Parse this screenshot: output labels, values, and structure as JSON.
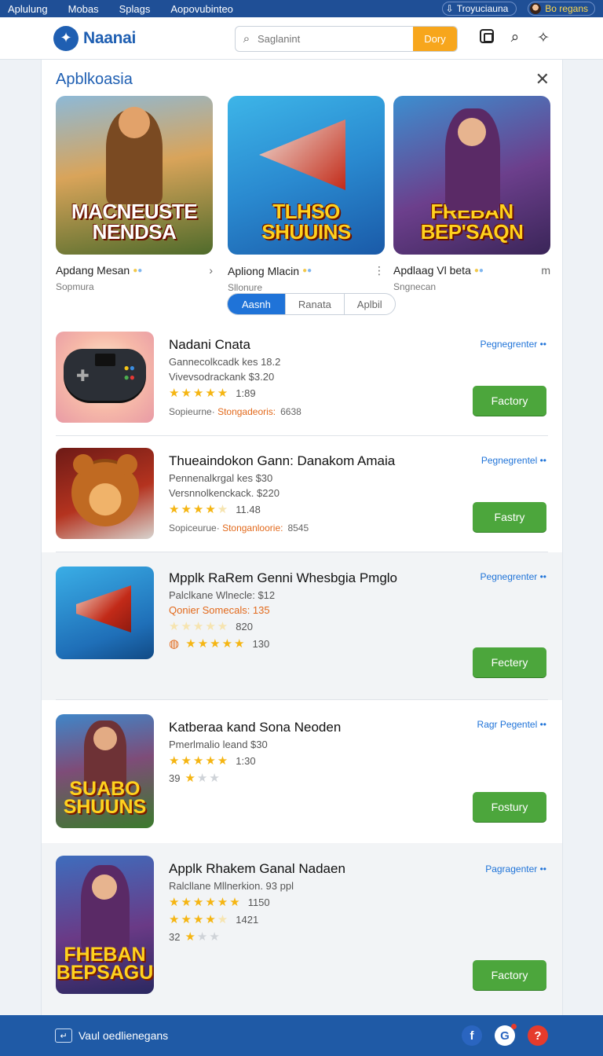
{
  "topbar": {
    "nav": [
      "Aplulung",
      "Mobas",
      "Splags",
      "Aopovubinteo"
    ],
    "user_label": "Troyuciauna",
    "account_label": "Bo regans"
  },
  "header": {
    "logo_text": "Naanai",
    "search_placeholder": "Saglanint",
    "search_button": "Dory"
  },
  "panel": {
    "title": "Apblkoasia",
    "featured": [
      {
        "art_text": "MACNEUSTE NENDSA",
        "name": "Apdang Mesan",
        "sub": "Sopmura",
        "more": "›"
      },
      {
        "art_text": "TLHSO SHUUINS",
        "name": "Apliong Mlacin",
        "sub": "Sllonure",
        "more": "⋮"
      },
      {
        "art_text": "FREBAN BEP'SAQN",
        "name": "Apdlaag Vl beta",
        "sub": "Sngnecan",
        "more": "m"
      }
    ],
    "tabs": [
      "Aasnh",
      "Ranata",
      "Aplbil"
    ]
  },
  "list": [
    {
      "name": "Nadani Cnata",
      "line1": "Gannecolkcadk kes 18.2",
      "line2": "Vivevsodrackank $3.20",
      "rating_count": "1:89",
      "meta_left": "Sopieurne·",
      "meta_highlight": "Stongadeoris:",
      "meta_num": "6638",
      "link": "Pegnegrenter ••",
      "button": "Factory"
    },
    {
      "name": "Thueaindokon Gann: Danakom Amaia",
      "line1": "Pennenalkrgal kes $30",
      "line2": "Versnnolkenckack. $220",
      "rating_count": "11.48",
      "meta_left": "Sopiceurue·",
      "meta_highlight": "Stonganloorie:",
      "meta_num": "8545",
      "link": "Pegnegrentel ••",
      "button": "Fastry"
    },
    {
      "name": "Mpplk RaRem Genni Whesbgia Pmglo",
      "line1": "Palclkane Wlnecle: $12",
      "line2": "Qonier Somecals: 135",
      "rating_count": "820",
      "rating2_count": "130",
      "link": "Pegnegrenter ••",
      "button": "Fectery"
    },
    {
      "name": "Katberaa kand Sona Neoden",
      "line1": "Pmerlmalio leand $30",
      "rating_count": "1:30",
      "rating2_count": "39",
      "link": "Ragr Pegentel ••",
      "button": "Fostury",
      "art_text": "SUABO SHUUNS"
    },
    {
      "name": "Applk Rhakem Ganal Nadaen",
      "line1": "Ralcllane Mllnerkion. 93 ppl",
      "rating_count": "1150",
      "rating2_count": "1421",
      "rating3_count": "32",
      "link": "Pagragenter ••",
      "button": "Factory",
      "art_text": "FHEBAN BEPSAGU"
    }
  ],
  "footer": {
    "left_label": "Vaul oedlienegans",
    "social": [
      "f",
      "G",
      "?"
    ]
  }
}
